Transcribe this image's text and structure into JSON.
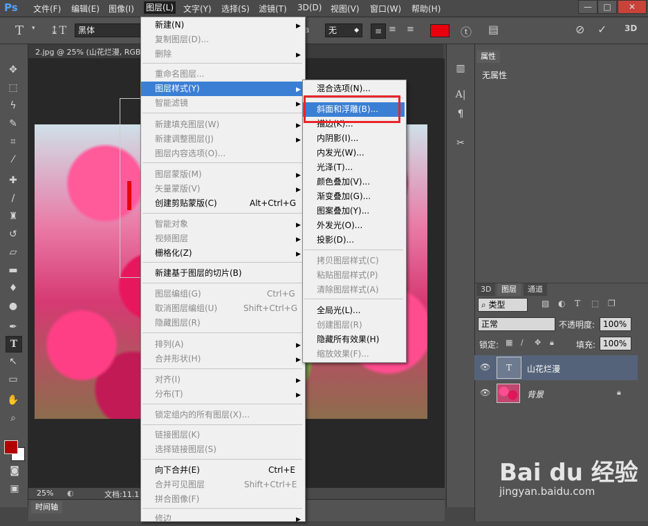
{
  "app": {
    "logo": "Ps"
  },
  "menubar": {
    "items": [
      "文件(F)",
      "编辑(E)",
      "图像(I)",
      "图层(L)",
      "文字(Y)",
      "选择(S)",
      "滤镜(T)",
      "3D(D)",
      "视图(V)",
      "窗口(W)",
      "帮助(H)"
    ],
    "window_buttons": [
      "—",
      "□",
      "✕"
    ]
  },
  "options": {
    "font_family": "黑体",
    "aa_label": "a",
    "aa_value": "无"
  },
  "colors": {
    "text_color": "#e8000f",
    "foreground": "#b30000",
    "background": "#ffffff"
  },
  "document": {
    "tab_title": "2.jpg @ 25% (山花烂漫, RGB",
    "zoom": "25%",
    "doc_info": "文档:11.1"
  },
  "timeline_label": "时间轴",
  "properties": {
    "tab": "属性",
    "content": "无属性"
  },
  "layers_panel": {
    "tabs": [
      "3D",
      "图层",
      "通道"
    ],
    "filter_type": "类型",
    "blend_mode": "正常",
    "opacity_label": "不透明度:",
    "opacity_value": "100%",
    "lock_label": "锁定:",
    "fill_label": "填充:",
    "fill_value": "100%",
    "layers": [
      {
        "name": "山花烂漫",
        "kind": "text",
        "selected": true
      },
      {
        "name": "背景",
        "kind": "image",
        "selected": false,
        "locked": true
      }
    ]
  },
  "layer_menu": {
    "items": [
      {
        "label": "新建(N)",
        "shortcut": "",
        "sub": true,
        "disabled": false
      },
      {
        "label": "复制图层(D)...",
        "shortcut": "",
        "sub": false,
        "disabled": true
      },
      {
        "label": "删除",
        "shortcut": "",
        "sub": true,
        "disabled": true
      },
      {
        "label": "重命名图层...",
        "shortcut": "",
        "sub": false,
        "disabled": true
      },
      {
        "label": "图层样式(Y)",
        "shortcut": "",
        "sub": true,
        "disabled": false,
        "selected": true
      },
      {
        "label": "智能滤镜",
        "shortcut": "",
        "sub": true,
        "disabled": true
      },
      {
        "label": "新建填充图层(W)",
        "shortcut": "",
        "sub": true,
        "disabled": true
      },
      {
        "label": "新建调整图层(J)",
        "shortcut": "",
        "sub": true,
        "disabled": true
      },
      {
        "label": "图层内容选项(O)...",
        "shortcut": "",
        "sub": false,
        "disabled": true
      },
      {
        "label": "图层蒙版(M)",
        "shortcut": "",
        "sub": true,
        "disabled": true
      },
      {
        "label": "矢量蒙版(V)",
        "shortcut": "",
        "sub": true,
        "disabled": true
      },
      {
        "label": "创建剪贴蒙版(C)",
        "shortcut": "Alt+Ctrl+G",
        "sub": false,
        "disabled": false
      },
      {
        "label": "智能对象",
        "shortcut": "",
        "sub": true,
        "disabled": true
      },
      {
        "label": "视频图层",
        "shortcut": "",
        "sub": true,
        "disabled": true
      },
      {
        "label": "栅格化(Z)",
        "shortcut": "",
        "sub": true,
        "disabled": false
      },
      {
        "label": "新建基于图层的切片(B)",
        "shortcut": "",
        "sub": false,
        "disabled": false
      },
      {
        "label": "图层编组(G)",
        "shortcut": "Ctrl+G",
        "sub": false,
        "disabled": true
      },
      {
        "label": "取消图层编组(U)",
        "shortcut": "Shift+Ctrl+G",
        "sub": false,
        "disabled": true
      },
      {
        "label": "隐藏图层(R)",
        "shortcut": "",
        "sub": false,
        "disabled": true
      },
      {
        "label": "排列(A)",
        "shortcut": "",
        "sub": true,
        "disabled": true
      },
      {
        "label": "合并形状(H)",
        "shortcut": "",
        "sub": true,
        "disabled": true
      },
      {
        "label": "对齐(I)",
        "shortcut": "",
        "sub": true,
        "disabled": true
      },
      {
        "label": "分布(T)",
        "shortcut": "",
        "sub": true,
        "disabled": true
      },
      {
        "label": "锁定组内的所有图层(X)...",
        "shortcut": "",
        "sub": false,
        "disabled": true
      },
      {
        "label": "链接图层(K)",
        "shortcut": "",
        "sub": false,
        "disabled": true
      },
      {
        "label": "选择链接图层(S)",
        "shortcut": "",
        "sub": false,
        "disabled": true
      },
      {
        "label": "向下合并(E)",
        "shortcut": "Ctrl+E",
        "sub": false,
        "disabled": false
      },
      {
        "label": "合并可见图层",
        "shortcut": "Shift+Ctrl+E",
        "sub": false,
        "disabled": true
      },
      {
        "label": "拼合图像(F)",
        "shortcut": "",
        "sub": false,
        "disabled": true
      },
      {
        "label": "修边",
        "shortcut": "",
        "sub": true,
        "disabled": true
      }
    ]
  },
  "style_submenu": {
    "items": [
      {
        "label": "混合选项(N)...",
        "disabled": false
      },
      {
        "label": "斜面和浮雕(B)...",
        "disabled": false,
        "selected": true
      },
      {
        "label": "描边(K)...",
        "disabled": false
      },
      {
        "label": "内阴影(I)...",
        "disabled": false
      },
      {
        "label": "内发光(W)...",
        "disabled": false
      },
      {
        "label": "光泽(T)...",
        "disabled": false
      },
      {
        "label": "颜色叠加(V)...",
        "disabled": false
      },
      {
        "label": "渐变叠加(G)...",
        "disabled": false
      },
      {
        "label": "图案叠加(Y)...",
        "disabled": false
      },
      {
        "label": "外发光(O)...",
        "disabled": false
      },
      {
        "label": "投影(D)...",
        "disabled": false
      },
      {
        "label": "拷贝图层样式(C)",
        "disabled": true
      },
      {
        "label": "粘贴图层样式(P)",
        "disabled": true
      },
      {
        "label": "清除图层样式(A)",
        "disabled": true
      },
      {
        "label": "全局光(L)...",
        "disabled": false
      },
      {
        "label": "创建图层(R)",
        "disabled": true
      },
      {
        "label": "隐藏所有效果(H)",
        "disabled": false
      },
      {
        "label": "缩放效果(F)...",
        "disabled": true
      }
    ]
  },
  "watermark": {
    "brand": "Bai du 经验",
    "url": "jingyan.baidu.com"
  }
}
